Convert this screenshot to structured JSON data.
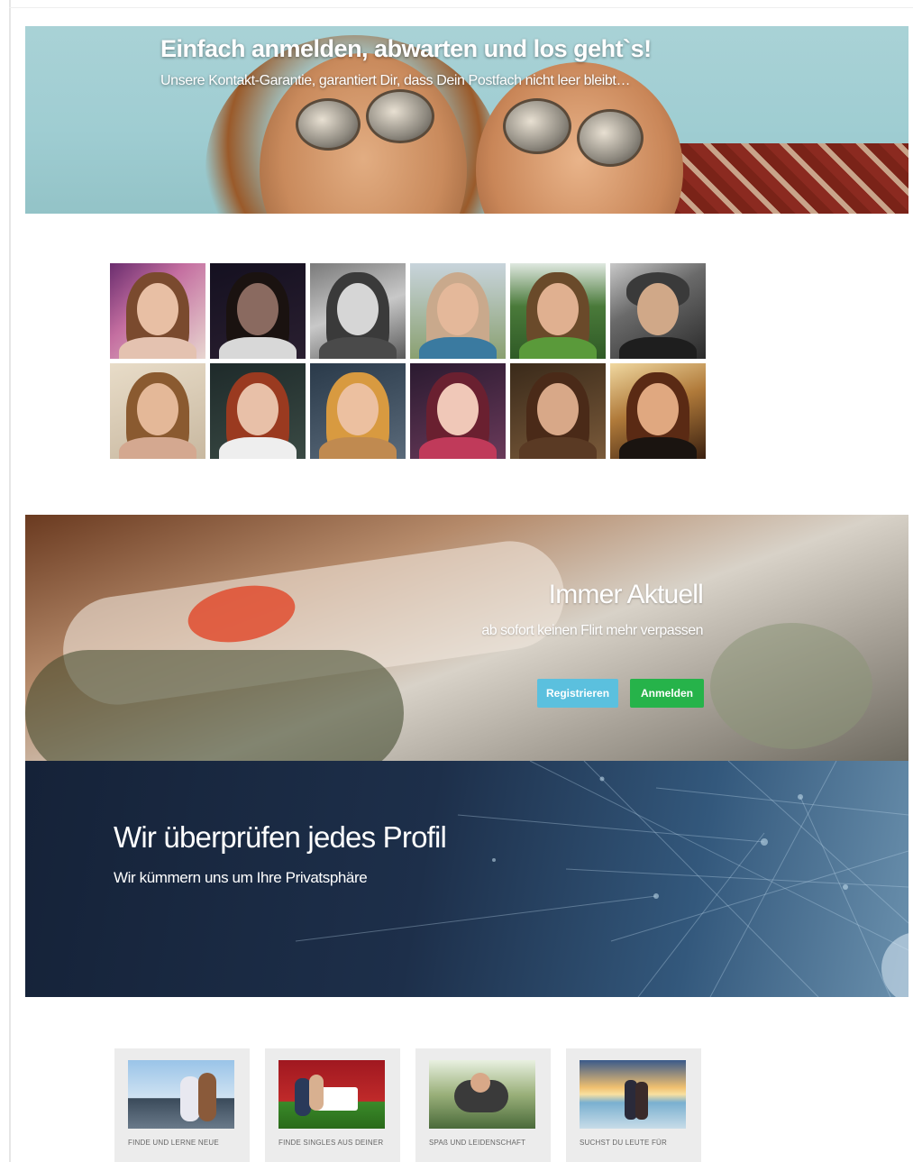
{
  "hero": {
    "title": "Einfach anmelden, abwarten und los geht`s!",
    "subtitle": "Unsere Kontakt-Garantie, garantiert Dir, dass Dein Postfach nicht leer bleibt…"
  },
  "profiles": [
    {
      "name": "profile-thumb-1"
    },
    {
      "name": "profile-thumb-2"
    },
    {
      "name": "profile-thumb-3"
    },
    {
      "name": "profile-thumb-4"
    },
    {
      "name": "profile-thumb-5"
    },
    {
      "name": "profile-thumb-6"
    },
    {
      "name": "profile-thumb-7"
    },
    {
      "name": "profile-thumb-8"
    },
    {
      "name": "profile-thumb-9"
    },
    {
      "name": "profile-thumb-10"
    },
    {
      "name": "profile-thumb-11"
    },
    {
      "name": "profile-thumb-12"
    }
  ],
  "aktuell": {
    "title": "Immer Aktuell",
    "subtitle": "ab sofort keinen Flirt mehr verpassen",
    "register_label": "Registrieren",
    "login_label": "Anmelden",
    "register_color": "#5bc0de",
    "login_color": "#26b34a"
  },
  "check": {
    "title": "Wir überprüfen jedes Profil",
    "subtitle": "Wir kümmern uns um Ihre Privatsphäre"
  },
  "cards": [
    {
      "caption": "FINDE UND LERNE NEUE"
    },
    {
      "caption": "FINDE SINGLES AUS DEINER"
    },
    {
      "caption": "SPAß UND LEIDENSCHAFT"
    },
    {
      "caption": "SUCHST DU LEUTE FÜR"
    }
  ]
}
